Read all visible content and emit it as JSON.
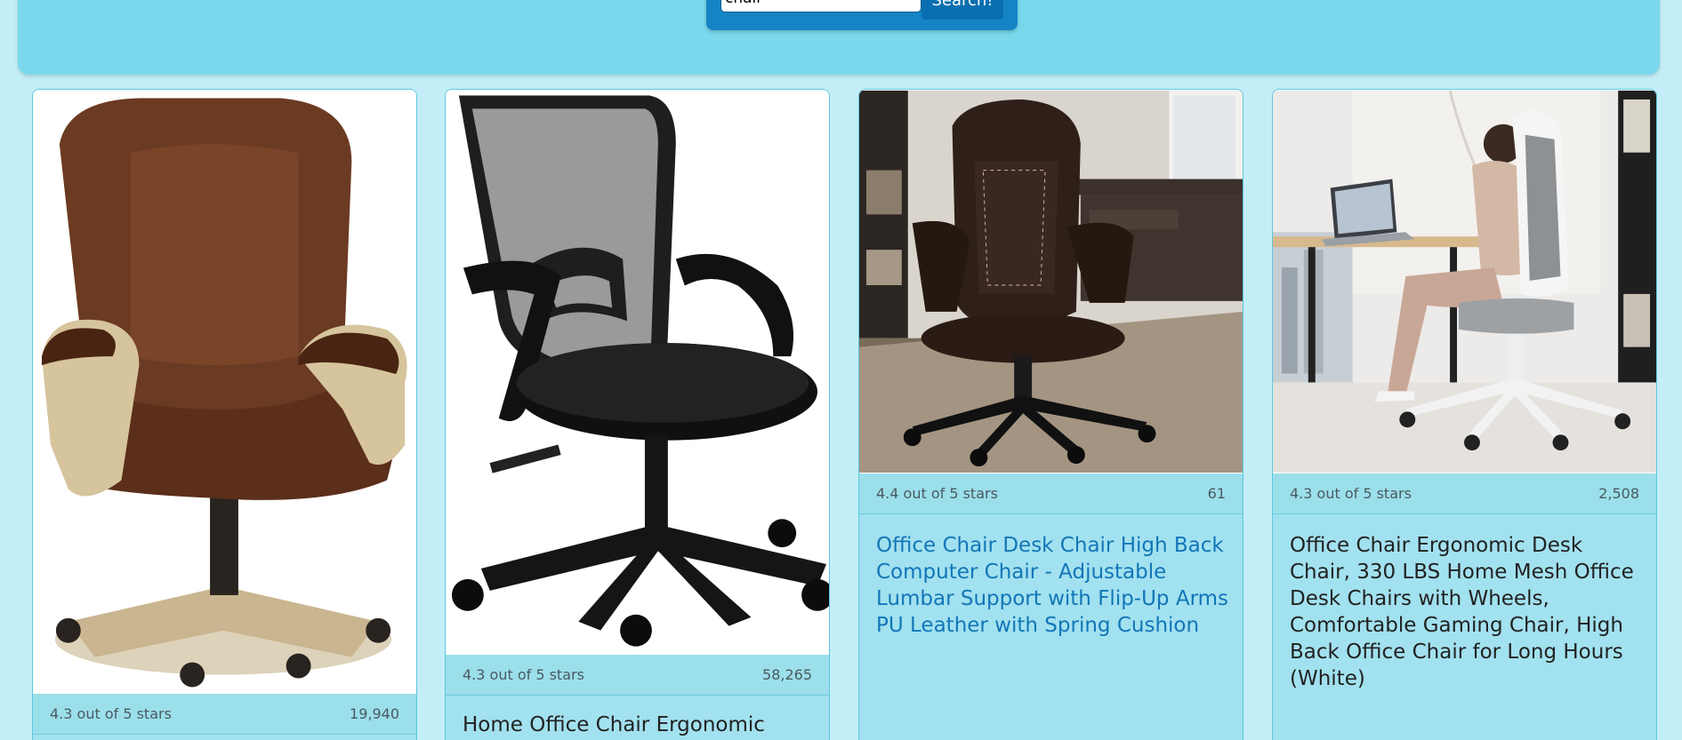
{
  "search": {
    "query": "chair",
    "button_label": "Search!"
  },
  "products": [
    {
      "rating": "4.3 out of 5 stars",
      "reviews": "19,940",
      "title": "",
      "image_icon": "brown-leather-executive-chair-image"
    },
    {
      "rating": "4.3 out of 5 stars",
      "reviews": "58,265",
      "title": "Home Office Chair Ergonomic",
      "image_icon": "black-mesh-office-chair-image"
    },
    {
      "rating": "4.4 out of 5 stars",
      "reviews": "61",
      "title": "Office Chair Desk Chair High Back Computer Chair - Adjustable Lumbar Support with Flip-Up Arms PU Leather with Spring Cushion",
      "image_icon": "brown-leather-chair-room-image"
    },
    {
      "rating": "4.3 out of 5 stars",
      "reviews": "2,508",
      "title": "Office Chair Ergonomic Desk Chair, 330 LBS Home Mesh Office Desk Chairs with Wheels, Comfortable Gaming Chair, High Back Office Chair for Long Hours (White)",
      "image_icon": "white-ergonomic-chair-image"
    }
  ],
  "colors": {
    "page_bg": "#c4eef7",
    "header_bg": "#79d8ec",
    "search_bg": "#1484c4",
    "card_bg": "#a2e1ef",
    "link_title": "#1276b8"
  }
}
